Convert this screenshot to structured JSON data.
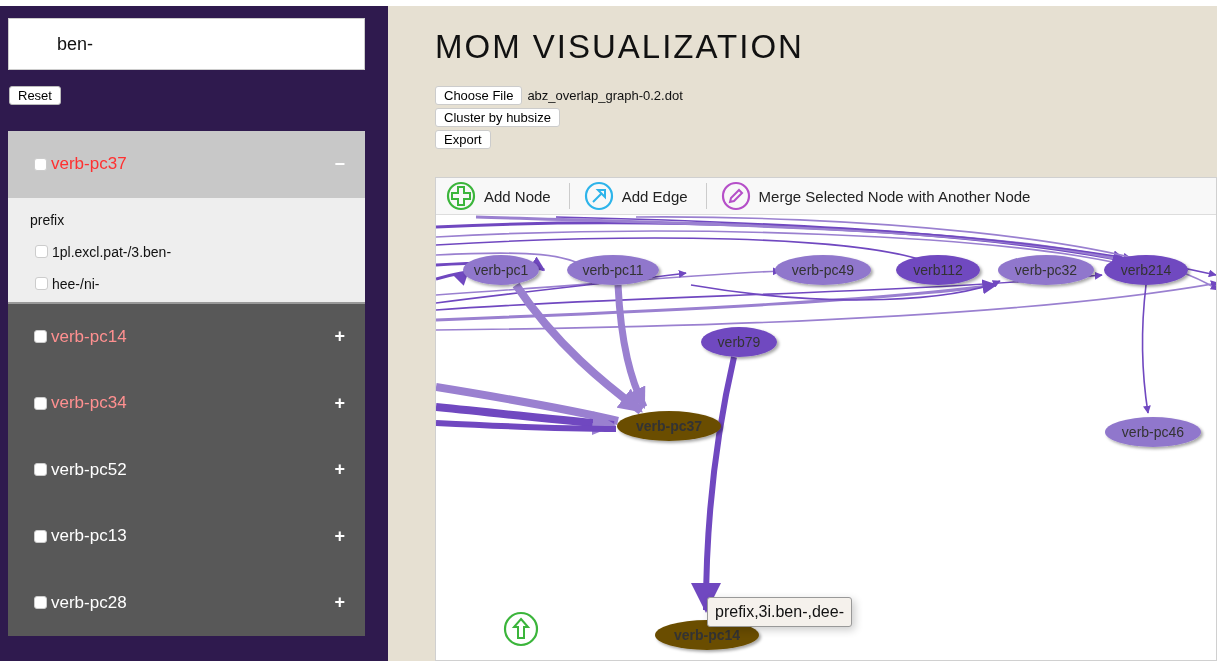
{
  "search": {
    "value": "ben-"
  },
  "reset_button": "Reset",
  "groups": [
    {
      "label": "verb-pc37",
      "matched": true,
      "checked": false,
      "expanded": true,
      "toggle": "−",
      "section": "prefix",
      "options": [
        {
          "label": "1pl.excl.pat-/3.ben-",
          "checked": false
        },
        {
          "label": "hee-/ni-",
          "checked": false
        }
      ]
    },
    {
      "label": "verb-pc14",
      "matched": true,
      "checked": false,
      "expanded": false,
      "toggle": "+"
    },
    {
      "label": "verb-pc34",
      "matched": true,
      "checked": false,
      "expanded": false,
      "toggle": "+"
    },
    {
      "label": "verb-pc52",
      "matched": false,
      "checked": false,
      "expanded": false,
      "toggle": "+"
    },
    {
      "label": "verb-pc13",
      "matched": false,
      "checked": false,
      "expanded": false,
      "toggle": "+"
    },
    {
      "label": "verb-pc28",
      "matched": false,
      "checked": false,
      "expanded": false,
      "toggle": "+"
    }
  ],
  "title": "MOM VISUALIZATION",
  "file_button": "Choose File",
  "file_name": "abz_overlap_graph-0.2.dot",
  "buttons": [
    "Cluster by hubsize",
    "Export"
  ],
  "toolbar": [
    {
      "label": "Add Node",
      "kind": "add-node"
    },
    {
      "label": "Add Edge",
      "kind": "add-edge"
    },
    {
      "label": "Merge Selected Node with Another Node",
      "kind": "merge"
    }
  ],
  "graph": {
    "nodes": [
      {
        "label": "verb-pc1",
        "color": "#9077cc"
      },
      {
        "label": "verb-pc11",
        "color": "#9077cc"
      },
      {
        "label": "verb-pc49",
        "color": "#9077cc"
      },
      {
        "label": "verb112",
        "color": "#7048c0"
      },
      {
        "label": "verb-pc32",
        "color": "#9077cc"
      },
      {
        "label": "verb214",
        "color": "#7048c0"
      },
      {
        "label": "verb79",
        "color": "#7048c0"
      },
      {
        "label": "verb-pc37",
        "color": "#6b4e00"
      },
      {
        "label": "verb-pc46",
        "color": "#9077cc"
      },
      {
        "label": "verb-pc14",
        "color": "#6b4e00"
      }
    ],
    "tooltip": "prefix,3i.ben-,dee-"
  }
}
